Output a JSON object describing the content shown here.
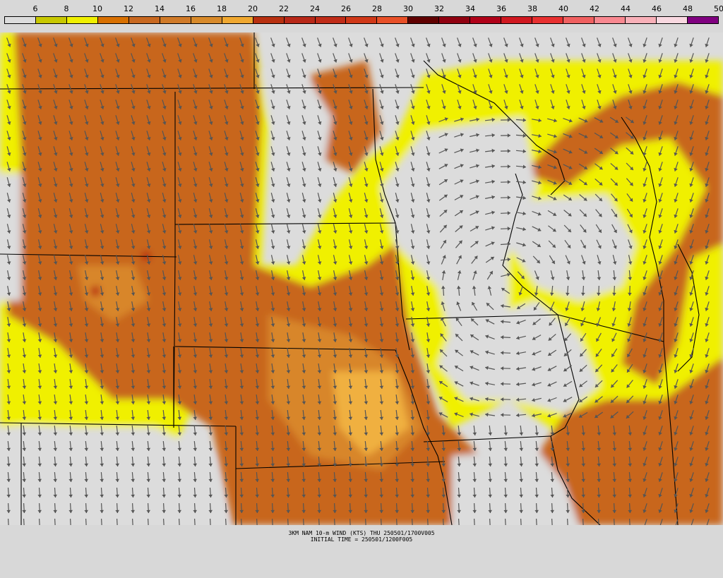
{
  "legend": {
    "labels": [
      "6",
      "8",
      "10",
      "12",
      "14",
      "16",
      "18",
      "20",
      "22",
      "24",
      "26",
      "28",
      "30",
      "32",
      "34",
      "36",
      "38",
      "40",
      "42",
      "44",
      "46",
      "48",
      "50"
    ],
    "colors": [
      "#dcdcdc",
      "#c8c800",
      "#f0f000",
      "#d87000",
      "#c86820",
      "#d07a28",
      "#d88a2a",
      "#f0a830",
      "#b83010",
      "#b82818",
      "#c02c18",
      "#d03818",
      "#e85028",
      "#600000",
      "#900010",
      "#b00018",
      "#d01820",
      "#e83030",
      "#f06060",
      "#f88890",
      "#f8b0b8",
      "#f8d8e0",
      "#800080"
    ]
  },
  "map": {
    "wind_colors": {
      "calm": "#dcdcdc",
      "light": "#c8c800",
      "yellow": "#f0f000",
      "orange": "#c8661c",
      "orange_light": "#d8862c",
      "peak": "#f0b040",
      "red": "#b82010"
    },
    "arrow_color": "#555555",
    "border_color": "#000000"
  },
  "caption": {
    "line1": "3KM NAM 10-m WIND (KTS) THU 250501/1700V005",
    "line2": "INITIAL TIME = 250501/1200F005"
  }
}
